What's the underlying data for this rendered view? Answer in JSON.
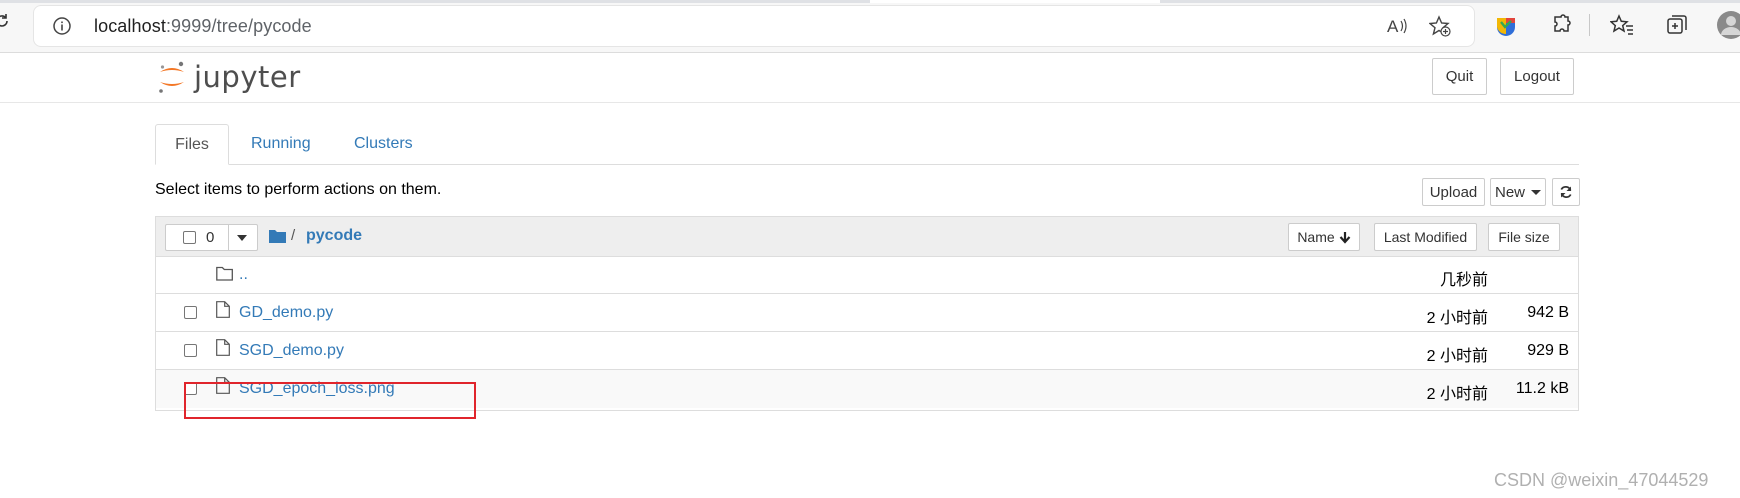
{
  "browser": {
    "url_host": "localhost",
    "url_path": ":9999/tree/pycode",
    "icons": [
      "reload-icon",
      "info-icon",
      "read-aloud-icon",
      "favorite-add-icon",
      "extension-color-icon",
      "puzzle-icon",
      "favorites-icon",
      "collections-icon",
      "profile-icon"
    ]
  },
  "header": {
    "logo_text": "jupyter",
    "quit_label": "Quit",
    "logout_label": "Logout"
  },
  "tabs": [
    {
      "label": "Files",
      "active": true
    },
    {
      "label": "Running",
      "active": false
    },
    {
      "label": "Clusters",
      "active": false
    }
  ],
  "hint": "Select items to perform actions on them.",
  "toolbar": {
    "upload_label": "Upload",
    "new_label": "New"
  },
  "list": {
    "selected_count": "0",
    "breadcrumb_sep": "/",
    "breadcrumb_dir": "pycode",
    "sort_name_label": "Name",
    "sort_modified_label": "Last Modified",
    "sort_size_label": "File size",
    "rows": [
      {
        "name": "..",
        "modified": "几秒前",
        "size": "",
        "type": "folder"
      },
      {
        "name": "GD_demo.py",
        "modified": "2 小时前",
        "size": "942 B",
        "type": "file"
      },
      {
        "name": "SGD_demo.py",
        "modified": "2 小时前",
        "size": "929 B",
        "type": "file"
      },
      {
        "name": "SGD_epoch_loss.png",
        "modified": "2 小时前",
        "size": "11.2 kB",
        "type": "file"
      }
    ]
  },
  "watermark": "CSDN @weixin_47044529",
  "colors": {
    "link": "#337ab7",
    "highlight": "#e0252c",
    "jupyter_orange": "#f37726"
  }
}
